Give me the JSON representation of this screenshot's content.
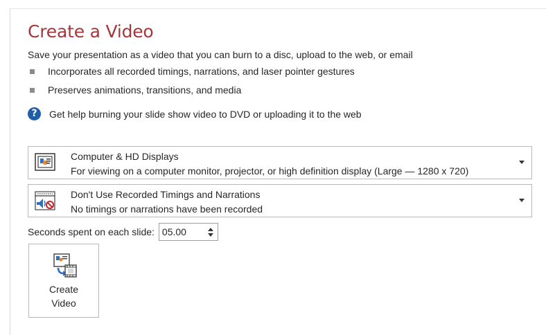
{
  "header": {
    "title": "Create a Video",
    "description": "Save your presentation as a video that you can burn to a disc, upload to the web, or email"
  },
  "bullets": [
    "Incorporates all recorded timings, narrations, and laser pointer gestures",
    "Preserves animations, transitions, and media"
  ],
  "help": {
    "link_text": "Get help burning your slide show video to DVD or uploading it to the web"
  },
  "quality_dropdown": {
    "title": "Computer & HD Displays",
    "subtitle": "For viewing on a computer monitor, projector, or high definition display  (Large — 1280 x 720)",
    "icon": "computer-display-icon"
  },
  "timings_dropdown": {
    "title": "Don't Use Recorded Timings and Narrations",
    "subtitle": "No timings or narrations have been recorded",
    "icon": "no-narration-icon"
  },
  "seconds": {
    "label": "Seconds spent on each slide:",
    "value": "05.00"
  },
  "create_button": {
    "label": "Create\nVideo",
    "icon": "create-video-icon"
  },
  "colors": {
    "title": "#a4373a",
    "help_icon": "#1f5fa8",
    "border": "#b8b8b8"
  }
}
